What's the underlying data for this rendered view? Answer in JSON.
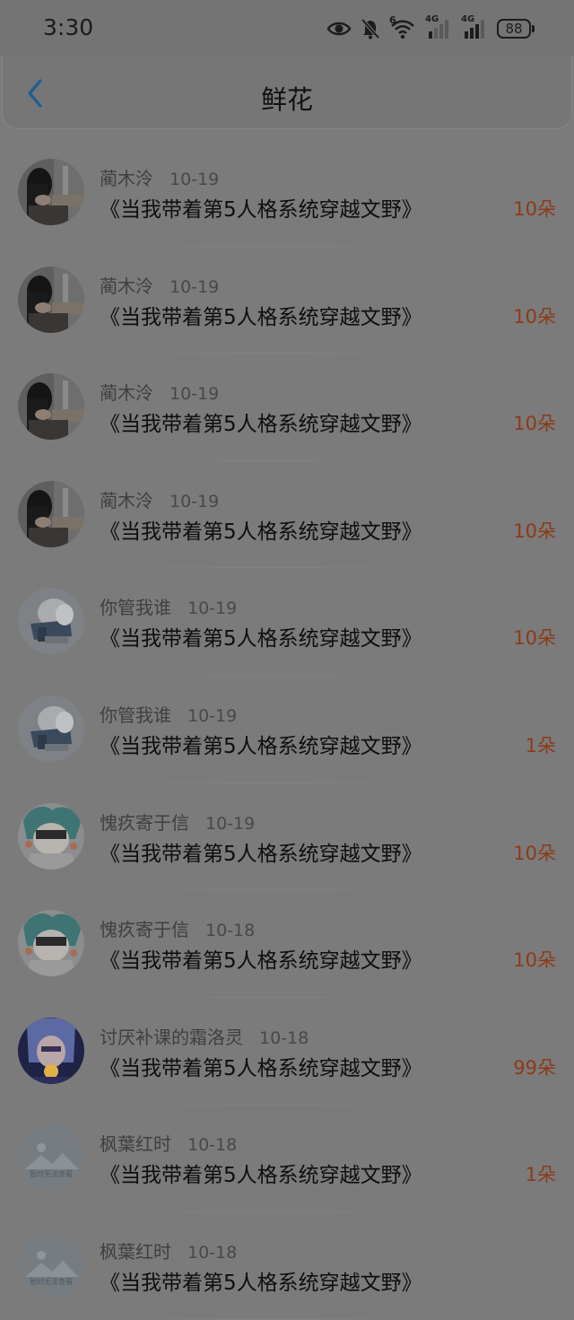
{
  "status_bar": {
    "time": "3:30",
    "battery": "88",
    "signal_label_1": "4G",
    "signal_label_2": "4G",
    "wifi_label": "6",
    "icons": [
      "eye-icon",
      "bell-off-icon",
      "wifi-icon",
      "cellular-signal-icon",
      "cellular-signal-icon",
      "battery-icon"
    ]
  },
  "header": {
    "title": "鲜花",
    "back_icon": "chevron-left-icon",
    "accent_color": "#1f5f8f"
  },
  "items": [
    {
      "user": "蔺木泠",
      "date": "10-19",
      "book": "《当我带着第5人格系统穿越文野》",
      "amount": "10朵",
      "avatar": "photo-girl"
    },
    {
      "user": "蔺木泠",
      "date": "10-19",
      "book": "《当我带着第5人格系统穿越文野》",
      "amount": "10朵",
      "avatar": "photo-girl"
    },
    {
      "user": "蔺木泠",
      "date": "10-19",
      "book": "《当我带着第5人格系统穿越文野》",
      "amount": "10朵",
      "avatar": "photo-girl"
    },
    {
      "user": "蔺木泠",
      "date": "10-19",
      "book": "《当我带着第5人格系统穿越文野》",
      "amount": "10朵",
      "avatar": "photo-girl"
    },
    {
      "user": "你管我谁",
      "date": "10-19",
      "book": "《当我带着第5人格系统穿越文野》",
      "amount": "10朵",
      "avatar": "anime-white"
    },
    {
      "user": "你管我谁",
      "date": "10-19",
      "book": "《当我带着第5人格系统穿越文野》",
      "amount": "1朵",
      "avatar": "anime-white"
    },
    {
      "user": "愧疚寄于信",
      "date": "10-19",
      "book": "《当我带着第5人格系统穿越文野》",
      "amount": "10朵",
      "avatar": "anime-teal"
    },
    {
      "user": "愧疚寄于信",
      "date": "10-18",
      "book": "《当我带着第5人格系统穿越文野》",
      "amount": "10朵",
      "avatar": "anime-teal"
    },
    {
      "user": "讨厌补课的霜洛灵",
      "date": "10-18",
      "book": "《当我带着第5人格系统穿越文野》",
      "amount": "99朵",
      "avatar": "anime-night"
    },
    {
      "user": "枫葉红时",
      "date": "10-18",
      "book": "《当我带着第5人格系统穿越文野》",
      "amount": "1朵",
      "avatar": "placeholder"
    },
    {
      "user": "枫葉红时",
      "date": "10-18",
      "book": "《当我带着第5人格系统穿越文野》",
      "amount": "",
      "avatar": "placeholder"
    }
  ],
  "avatar_placeholder_text": "暂时无法查看",
  "colors": {
    "amount": "#8c3a17",
    "overlay_background": "#7b7b7b"
  }
}
